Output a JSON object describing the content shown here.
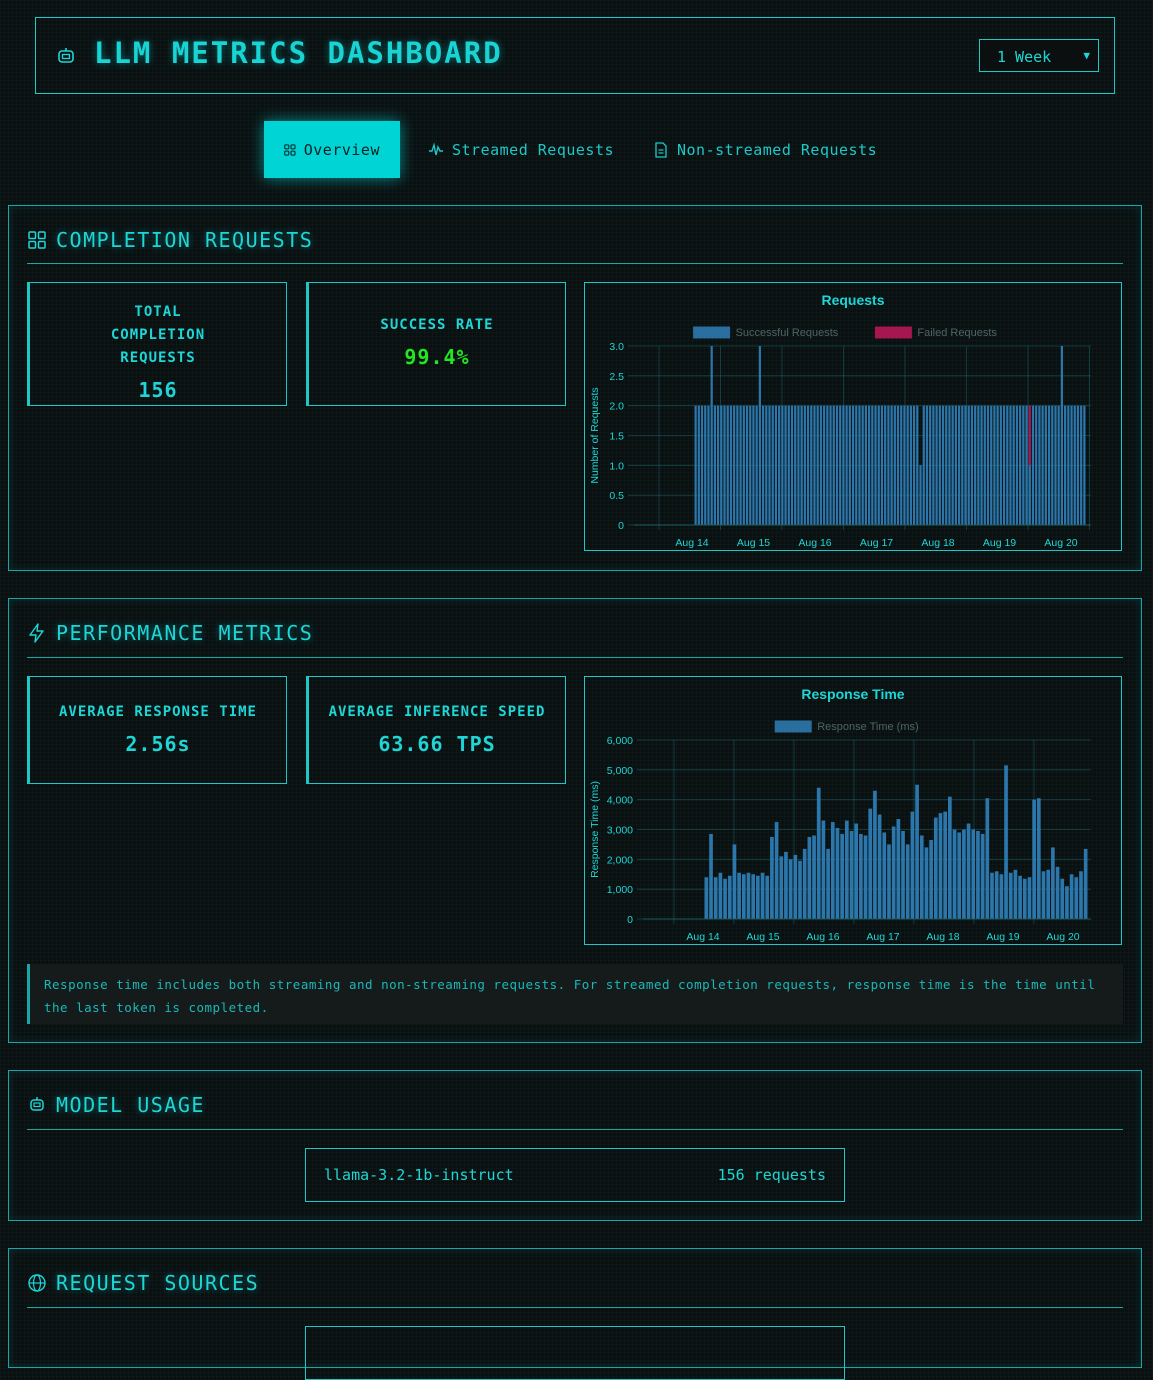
{
  "header": {
    "title": "LLM METRICS DASHBOARD",
    "range_selected": "1 Week"
  },
  "tabs": [
    {
      "label": "Overview",
      "icon": "grid-icon",
      "active": true
    },
    {
      "label": "Streamed Requests",
      "icon": "activity-icon",
      "active": false
    },
    {
      "label": "Non-streamed Requests",
      "icon": "document-icon",
      "active": false
    }
  ],
  "completion": {
    "title": "COMPLETION REQUESTS",
    "total_label": "TOTAL COMPLETION REQUESTS",
    "total_value": "156",
    "success_label": "SUCCESS RATE",
    "success_value": "99.4%"
  },
  "performance": {
    "title": "PERFORMANCE METRICS",
    "resp_label": "AVERAGE RESPONSE TIME",
    "resp_value": "2.56s",
    "speed_label": "AVERAGE INFERENCE SPEED",
    "speed_value": "63.66 TPS",
    "note": "Response time includes both streaming and non-streaming requests. For streamed completion requests, response time is the time until the last token is completed."
  },
  "model_usage": {
    "title": "MODEL USAGE",
    "models": [
      {
        "name": "llama-3.2-1b-instruct",
        "count": "156 requests"
      }
    ]
  },
  "request_sources": {
    "title": "REQUEST SOURCES"
  },
  "colors": {
    "accent": "#1fd6d6",
    "success_bar": "#2f7fb8",
    "failed_bar": "#c2185b",
    "success_text": "#22e622"
  },
  "chart_data": [
    {
      "type": "bar",
      "title": "Requests",
      "xlabel": "",
      "ylabel": "Number of Requests",
      "x_tick_labels": [
        "Aug 14",
        "Aug 15",
        "Aug 16",
        "Aug 17",
        "Aug 18",
        "Aug 19",
        "Aug 20"
      ],
      "ylim": [
        0,
        3
      ],
      "y_ticks": [
        "0",
        "0.5",
        "1.0",
        "1.5",
        "2.0",
        "2.5",
        "3.0"
      ],
      "legend": "top-center",
      "series": [
        {
          "name": "Successful Requests",
          "values": [
            2,
            2,
            2,
            2,
            2,
            3,
            2,
            2,
            2,
            2,
            2,
            2,
            2,
            2,
            2,
            2,
            2,
            2,
            2,
            2,
            3,
            2,
            2,
            2,
            2,
            2,
            2,
            2,
            2,
            2,
            2,
            2,
            2,
            2,
            2,
            2,
            2,
            2,
            2,
            2,
            2,
            2,
            2,
            2,
            2,
            2,
            2,
            2,
            2,
            2,
            2,
            2,
            2,
            2,
            2,
            2,
            2,
            2,
            2,
            2,
            2,
            2,
            2,
            2,
            2,
            2,
            2,
            2,
            2,
            2,
            1,
            2,
            2,
            2,
            2,
            2,
            2,
            2,
            2,
            2,
            2,
            2,
            2,
            2,
            2,
            2,
            2,
            2,
            2,
            2,
            2,
            2,
            2,
            2,
            2,
            2,
            2,
            2,
            2,
            2,
            2,
            2,
            2,
            2,
            1,
            2,
            2,
            2,
            2,
            2,
            2,
            2,
            2,
            2,
            3,
            2,
            2,
            2,
            2,
            2,
            2,
            2
          ]
        },
        {
          "name": "Failed Requests",
          "values": [
            0,
            0,
            0,
            0,
            0,
            0,
            0,
            0,
            0,
            0,
            0,
            0,
            0,
            0,
            0,
            0,
            0,
            0,
            0,
            0,
            0,
            0,
            0,
            0,
            0,
            0,
            0,
            0,
            0,
            0,
            0,
            0,
            0,
            0,
            0,
            0,
            0,
            0,
            0,
            0,
            0,
            0,
            0,
            0,
            0,
            0,
            0,
            0,
            0,
            0,
            0,
            0,
            0,
            0,
            0,
            0,
            0,
            0,
            0,
            0,
            0,
            0,
            0,
            0,
            0,
            0,
            0,
            0,
            0,
            0,
            0,
            0,
            0,
            0,
            0,
            0,
            0,
            0,
            0,
            0,
            0,
            0,
            0,
            0,
            0,
            0,
            0,
            0,
            0,
            0,
            0,
            0,
            0,
            0,
            0,
            0,
            0,
            0,
            0,
            0,
            0,
            0,
            0,
            0,
            1,
            0,
            0,
            0,
            0,
            0,
            0,
            0,
            0,
            0,
            0,
            0,
            0,
            0,
            0,
            0,
            0,
            0
          ]
        }
      ]
    },
    {
      "type": "bar",
      "title": "Response Time",
      "xlabel": "",
      "ylabel": "Response Time (ms)",
      "x_tick_labels": [
        "Aug 14",
        "Aug 15",
        "Aug 16",
        "Aug 17",
        "Aug 18",
        "Aug 19",
        "Aug 20"
      ],
      "ylim": [
        0,
        6000
      ],
      "y_ticks": [
        "0",
        "1,000",
        "2,000",
        "3,000",
        "4,000",
        "5,000",
        "6,000"
      ],
      "legend": "top-center",
      "series": [
        {
          "name": "Response Time (ms)",
          "values": [
            1400,
            2850,
            1400,
            1550,
            1350,
            1450,
            2500,
            1550,
            1500,
            1550,
            1500,
            1450,
            1550,
            1450,
            2750,
            3250,
            2100,
            2250,
            2000,
            2150,
            1950,
            2350,
            2750,
            2800,
            4400,
            3300,
            2350,
            3250,
            3050,
            2850,
            3300,
            2950,
            3200,
            2850,
            2800,
            3700,
            4300,
            3500,
            2900,
            2500,
            3100,
            3350,
            2950,
            2500,
            3600,
            4500,
            2800,
            2400,
            2650,
            3400,
            3550,
            3600,
            4100,
            3000,
            2900,
            3000,
            3200,
            3000,
            2950,
            2850,
            4050,
            1550,
            1600,
            1500,
            5150,
            1550,
            1650,
            1450,
            1350,
            1400,
            4000,
            4050,
            1600,
            1650,
            2400,
            1750,
            1350,
            1100,
            1500,
            1400,
            1600,
            2350
          ]
        }
      ]
    }
  ]
}
